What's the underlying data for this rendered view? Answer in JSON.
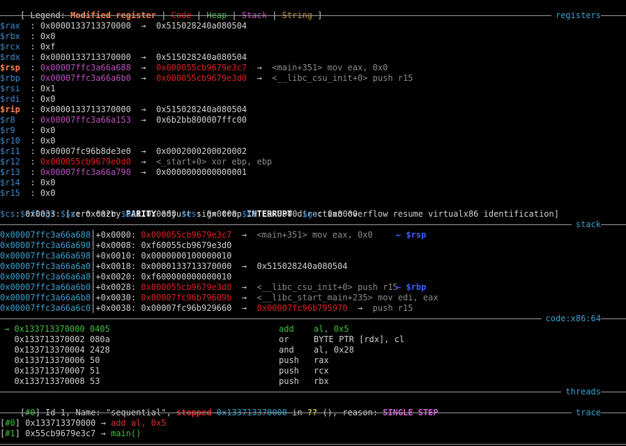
{
  "legend": {
    "prefix": "[ Legend: ",
    "modified": "Modified register",
    "sep": " | ",
    "code": "Code",
    "heap": "Heap",
    "stack": "Stack",
    "string": "String",
    "suffix": " ]"
  },
  "sections": {
    "registers": "registers",
    "stack": "stack",
    "code": "code:x86:64",
    "threads": "threads",
    "trace": "trace"
  },
  "registers": [
    {
      "name": "$rax",
      "modified": false,
      "value": "0x0000133713370000",
      "value_color": "val",
      "chain": [
        {
          "t": "→",
          "c": "arrow"
        },
        {
          "t": "0x515028240a080504",
          "c": "val"
        }
      ]
    },
    {
      "name": "$rbx",
      "modified": false,
      "value": "0x0",
      "value_color": "val",
      "chain": []
    },
    {
      "name": "$rcx",
      "modified": false,
      "value": "0xf",
      "value_color": "val",
      "chain": []
    },
    {
      "name": "$rdx",
      "modified": false,
      "value": "0x0000133713370000",
      "value_color": "val",
      "chain": [
        {
          "t": "→",
          "c": "arrow"
        },
        {
          "t": "0x515028240a080504",
          "c": "val"
        }
      ]
    },
    {
      "name": "$rsp",
      "modified": true,
      "value": "0x00007ffc3a66a688",
      "value_color": "stack",
      "chain": [
        {
          "t": "→",
          "c": "arrow"
        },
        {
          "t": "0x000055cb9679e3c7",
          "c": "code"
        },
        {
          "t": "→",
          "c": "arrow"
        },
        {
          "t": "<main+351> mov eax, 0x0",
          "c": "sym"
        }
      ]
    },
    {
      "name": "$rbp",
      "modified": false,
      "value": "0x00007ffc3a66a6b0",
      "value_color": "stack",
      "chain": [
        {
          "t": "→",
          "c": "arrow"
        },
        {
          "t": "0x000055cb9679e3d0",
          "c": "code"
        },
        {
          "t": "→",
          "c": "arrow"
        },
        {
          "t": "<__libc_csu_init+0> push r15",
          "c": "sym"
        }
      ]
    },
    {
      "name": "$rsi",
      "modified": false,
      "value": "0x1",
      "value_color": "val",
      "chain": []
    },
    {
      "name": "$rdi",
      "modified": false,
      "value": "0x0",
      "value_color": "val",
      "chain": []
    },
    {
      "name": "$rip",
      "modified": true,
      "value": "0x0000133713370000",
      "value_color": "val",
      "chain": [
        {
          "t": "→",
          "c": "arrow"
        },
        {
          "t": "0x515028240a080504",
          "c": "val"
        }
      ]
    },
    {
      "name": "$r8 ",
      "modified": false,
      "value": "0x00007ffc3a66a153",
      "value_color": "stack",
      "chain": [
        {
          "t": "→",
          "c": "arrow"
        },
        {
          "t": "0x6b2bb800007ffc00",
          "c": "val"
        }
      ]
    },
    {
      "name": "$r9 ",
      "modified": false,
      "value": "0x0",
      "value_color": "val",
      "chain": []
    },
    {
      "name": "$r10",
      "modified": false,
      "value": "0x0",
      "value_color": "val",
      "chain": []
    },
    {
      "name": "$r11",
      "modified": false,
      "value": "0x00007fc96b8de3e0",
      "value_color": "val",
      "chain": [
        {
          "t": "→",
          "c": "arrow"
        },
        {
          "t": "0x0002000200020002",
          "c": "val"
        }
      ]
    },
    {
      "name": "$r12",
      "modified": false,
      "value": "0x000055cb9679e0d0",
      "value_color": "code",
      "chain": [
        {
          "t": "→",
          "c": "arrow"
        },
        {
          "t": "<_start+0> xor ebp, ebp",
          "c": "sym"
        }
      ]
    },
    {
      "name": "$r13",
      "modified": false,
      "value": "0x00007ffc3a66a790",
      "value_color": "stack",
      "chain": [
        {
          "t": "→",
          "c": "arrow"
        },
        {
          "t": "0x0000000000000001",
          "c": "val"
        }
      ]
    },
    {
      "name": "$r14",
      "modified": false,
      "value": "0x0",
      "value_color": "val",
      "chain": []
    },
    {
      "name": "$r15",
      "modified": false,
      "value": "0x0",
      "value_color": "val",
      "chain": []
    }
  ],
  "eflags": {
    "name": "$eflags",
    "parts": [
      {
        "t": "[zero carry ",
        "c": "white"
      },
      {
        "t": "PARITY",
        "c": "flag-on"
      },
      {
        "t": " adjust sign trap ",
        "c": "white"
      },
      {
        "t": "INTERRUPT",
        "c": "flag-on"
      },
      {
        "t": " direction overflow resume virtualx86 identification]",
        "c": "white"
      }
    ]
  },
  "segments": [
    {
      "name": "$cs",
      "value": "0x0033"
    },
    {
      "name": "$ss",
      "value": "0x002b"
    },
    {
      "name": "$ds",
      "value": "0x0000"
    },
    {
      "name": "$es",
      "value": "0x0000"
    },
    {
      "name": "$fs",
      "value": "0x0000"
    },
    {
      "name": "$gs",
      "value": "0x0000"
    }
  ],
  "stack": [
    {
      "addr": "0x00007ffc3a66a688",
      "off": "+0x0000",
      "parts": [
        {
          "t": "0x000055cb9679e3c7",
          "c": "code"
        },
        {
          "t": "  →  ",
          "c": "arrow"
        },
        {
          "t": "<main+351> mov eax, 0x0",
          "c": "sym"
        }
      ],
      "tag": "← $rsp"
    },
    {
      "addr": "0x00007ffc3a66a690",
      "off": "+0x0008",
      "parts": [
        {
          "t": "0xf60055cb9679e3d0",
          "c": "val"
        }
      ],
      "tag": ""
    },
    {
      "addr": "0x00007ffc3a66a698",
      "off": "+0x0010",
      "parts": [
        {
          "t": "0x0000000100000010",
          "c": "val"
        }
      ],
      "tag": ""
    },
    {
      "addr": "0x00007ffc3a66a6a0",
      "off": "+0x0018",
      "parts": [
        {
          "t": "0x0000133713370000",
          "c": "val"
        },
        {
          "t": "  →  ",
          "c": "arrow"
        },
        {
          "t": "0x515028240a080504",
          "c": "val"
        }
      ],
      "tag": ""
    },
    {
      "addr": "0x00007ffc3a66a6a8",
      "off": "+0x0020",
      "parts": [
        {
          "t": "0xf600000000000010",
          "c": "val"
        }
      ],
      "tag": ""
    },
    {
      "addr": "0x00007ffc3a66a6b0",
      "off": "+0x0028",
      "parts": [
        {
          "t": "0x000055cb9679e3d0",
          "c": "code"
        },
        {
          "t": "  →  ",
          "c": "arrow"
        },
        {
          "t": "<__libc_csu_init+0> push r15",
          "c": "sym"
        }
      ],
      "tag": "← $rbp"
    },
    {
      "addr": "0x00007ffc3a66a6b8",
      "off": "+0x0030",
      "parts": [
        {
          "t": "0x00007fc96b79609b",
          "c": "code"
        },
        {
          "t": "  →  ",
          "c": "arrow"
        },
        {
          "t": "<__libc_start_main+235> mov edi, eax",
          "c": "sym"
        }
      ],
      "tag": ""
    },
    {
      "addr": "0x00007ffc3a66a6c0",
      "off": "+0x0038",
      "parts": [
        {
          "t": "0x00007fc96b929660",
          "c": "val"
        },
        {
          "t": "  →  ",
          "c": "arrow"
        },
        {
          "t": "0x00007fc96b795970",
          "c": "code"
        },
        {
          "t": "  →  ",
          "c": "arrow"
        },
        {
          "t": "push r15",
          "c": "sym"
        }
      ],
      "tag": ""
    }
  ],
  "code": [
    {
      "current": true,
      "marker": "→",
      "addr": "0x133713370000",
      "bytes": "0405",
      "mnem": "add",
      "ops": "al, 0x5"
    },
    {
      "current": false,
      "marker": "",
      "addr": "0x133713370002",
      "bytes": "080a",
      "mnem": "or",
      "ops": "BYTE PTR [rdx], cl"
    },
    {
      "current": false,
      "marker": "",
      "addr": "0x133713370004",
      "bytes": "2428",
      "mnem": "and",
      "ops": "al, 0x28"
    },
    {
      "current": false,
      "marker": "",
      "addr": "0x133713370006",
      "bytes": "50",
      "mnem": "push",
      "ops": "rax"
    },
    {
      "current": false,
      "marker": "",
      "addr": "0x133713370007",
      "bytes": "51",
      "mnem": "push",
      "ops": "rcx"
    },
    {
      "current": false,
      "marker": "",
      "addr": "0x133713370008",
      "bytes": "53",
      "mnem": "push",
      "ops": "rbx"
    }
  ],
  "threads": {
    "index": "#0",
    "text1": " Id 1, Name: \"sequential\", ",
    "state": "stopped",
    "addr": "0x133713370000",
    "text2": " in ",
    "func": "??",
    "text3": " (), reason: ",
    "reason": "SINGLE STEP"
  },
  "trace": [
    {
      "index": "#0",
      "addr": "0x133713370000",
      "arrow": "→",
      "target": "add al, 0x5",
      "target_color": "red"
    },
    {
      "index": "#1",
      "addr": "0x55cb9679e3c7",
      "arrow": "→",
      "target": "main()",
      "target_color": "green"
    }
  ]
}
